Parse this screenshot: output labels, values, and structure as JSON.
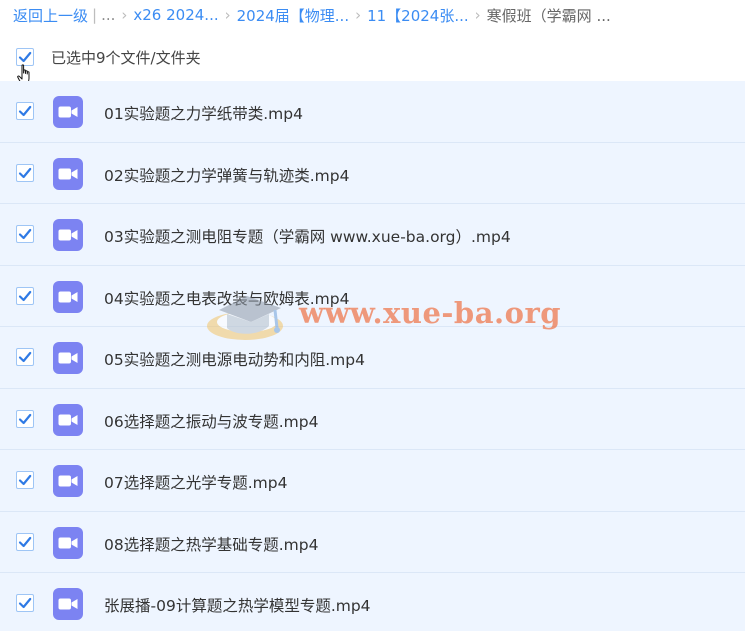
{
  "breadcrumb": {
    "back": "返回上一级",
    "ellipsis": "...",
    "items": [
      "x26 2024...",
      "2024届【物理...",
      "11【2024张...",
      "寒假班（学霸网 ..."
    ]
  },
  "selection": {
    "label": "已选中9个文件/文件夹",
    "checked": true
  },
  "files": [
    {
      "name": "01实验题之力学纸带类.mp4",
      "checked": true,
      "icon": "video-file-icon"
    },
    {
      "name": "02实验题之力学弹簧与轨迹类.mp4",
      "checked": true,
      "icon": "video-file-icon"
    },
    {
      "name": "03实验题之测电阻专题（学霸网 www.xue-ba.org）.mp4",
      "checked": true,
      "icon": "video-file-icon"
    },
    {
      "name": "04实验题之电表改装与欧姆表.mp4",
      "checked": true,
      "icon": "video-file-icon"
    },
    {
      "name": "05实验题之测电源电动势和内阻.mp4",
      "checked": true,
      "icon": "video-file-icon"
    },
    {
      "name": "06选择题之振动与波专题.mp4",
      "checked": true,
      "icon": "video-file-icon"
    },
    {
      "name": "07选择题之光学专题.mp4",
      "checked": true,
      "icon": "video-file-icon"
    },
    {
      "name": "08选择题之热学基础专题.mp4",
      "checked": true,
      "icon": "video-file-icon"
    },
    {
      "name": "张展播-09计算题之热学模型专题.mp4",
      "checked": true,
      "icon": "video-file-icon"
    }
  ],
  "watermark": {
    "text": "www.xue-ba.org"
  },
  "colors": {
    "link": "#3b8cf3",
    "row_bg": "#eef5ff",
    "check": "#2f7ae5",
    "video_icon": "#7c83f2",
    "watermark": "#ee602a"
  }
}
